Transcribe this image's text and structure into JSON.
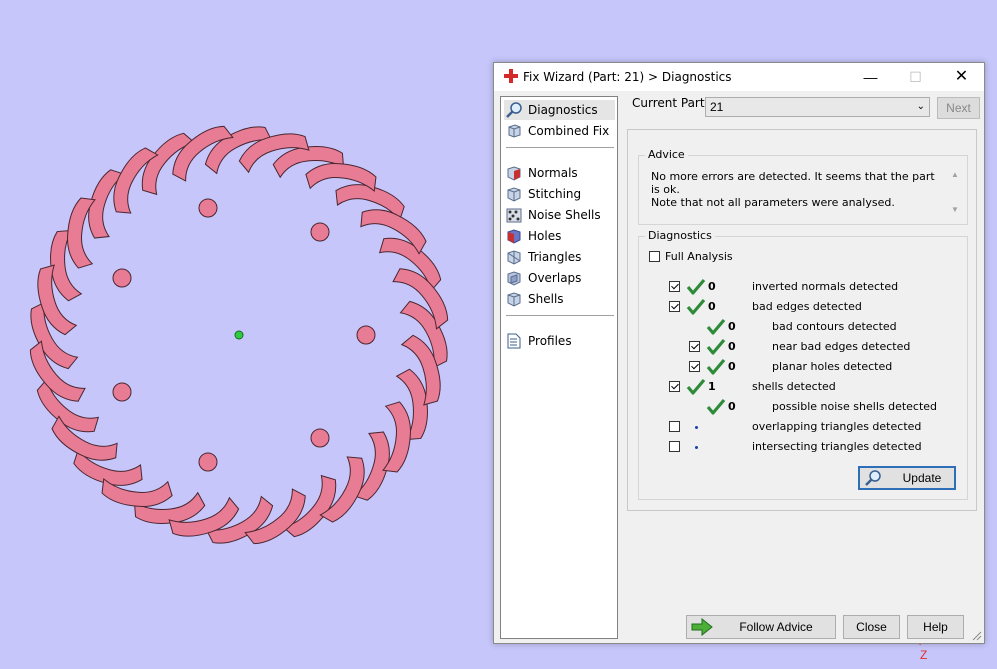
{
  "window": {
    "title": "Fix Wizard (Part: 21) > Diagnostics",
    "controls": {
      "minimize": "—",
      "maximize": "☐",
      "close": "✕"
    }
  },
  "viewport": {
    "axis_label": "Z",
    "model_color": "#e87c95"
  },
  "nav": {
    "items": [
      {
        "label": "Diagnostics",
        "icon": "magnifier-icon",
        "selected": true
      },
      {
        "label": "Combined Fix",
        "icon": "cube-icon"
      },
      {
        "label": "Normals",
        "icon": "normals-cube-icon"
      },
      {
        "label": "Stitching",
        "icon": "stitching-cube-icon"
      },
      {
        "label": "Noise Shells",
        "icon": "noise-shells-icon"
      },
      {
        "label": "Holes",
        "icon": "holes-cube-icon"
      },
      {
        "label": "Triangles",
        "icon": "triangles-cube-icon"
      },
      {
        "label": "Overlaps",
        "icon": "overlaps-cube-icon"
      },
      {
        "label": "Shells",
        "icon": "shells-cube-icon"
      },
      {
        "label": "Profiles",
        "icon": "profiles-document-icon"
      }
    ]
  },
  "current_part": {
    "label": "Current Part:",
    "value": "21"
  },
  "next_button": "Next",
  "advice": {
    "title": "Advice",
    "line1": "No more errors are detected. It seems that the part is ok.",
    "line2": "Note that not all parameters were analysed."
  },
  "diagnostics": {
    "title": "Diagnostics",
    "full_analysis": {
      "label": "Full Analysis",
      "checked": false
    },
    "rows": [
      {
        "checked": true,
        "status": "ok",
        "count": "0",
        "label": "inverted normals detected"
      },
      {
        "checked": true,
        "status": "ok",
        "count": "0",
        "label": "bad edges detected"
      },
      {
        "checkbox": false,
        "status": "ok",
        "count": "0",
        "label": "bad contours detected"
      },
      {
        "checked": true,
        "status": "ok",
        "count": "0",
        "label": "near bad edges detected"
      },
      {
        "checked": true,
        "status": "ok",
        "count": "0",
        "label": "planar holes detected"
      },
      {
        "checked": true,
        "status": "ok",
        "count": "1",
        "label": "shells detected"
      },
      {
        "checkbox": false,
        "status": "ok",
        "count": "0",
        "label": "possible noise shells detected"
      },
      {
        "checked": false,
        "status": "pending",
        "count": "",
        "label": "overlapping triangles detected"
      },
      {
        "checked": false,
        "status": "pending",
        "count": "",
        "label": "intersecting triangles detected"
      }
    ]
  },
  "buttons": {
    "update": "Update",
    "follow_advice": "Follow Advice",
    "close": "Close",
    "help": "Help"
  },
  "colors": {
    "background": "#c6c6fb",
    "check_green": "#2e8b3a",
    "accent_blue": "#2f6fb8"
  }
}
